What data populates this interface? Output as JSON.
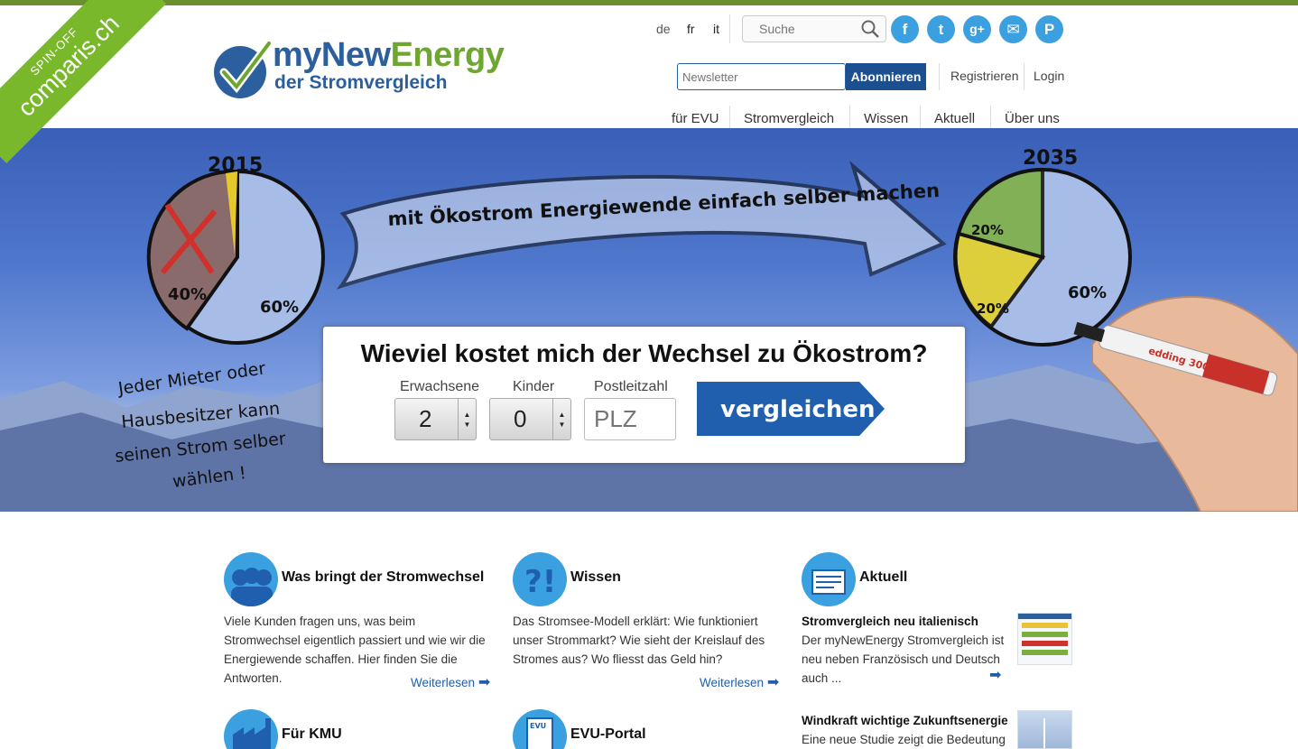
{
  "ribbon": {
    "small": "SPIN-OFF",
    "big": "comparis.ch"
  },
  "logo": {
    "brand_a": "myNew",
    "brand_b": "Energy",
    "subtitle": "der Stromvergleich"
  },
  "languages": [
    "de",
    "fr",
    "it"
  ],
  "search": {
    "placeholder": "Suche",
    "icon": "search-icon"
  },
  "social": [
    {
      "name": "facebook-icon",
      "glyph": "f"
    },
    {
      "name": "twitter-icon",
      "glyph": "t"
    },
    {
      "name": "googleplus-icon",
      "glyph": "g+"
    },
    {
      "name": "email-icon",
      "glyph": "✉"
    },
    {
      "name": "pinterest-icon",
      "glyph": "P"
    }
  ],
  "newsletter": {
    "placeholder": "Newsletter",
    "button": "Abonnieren"
  },
  "account": {
    "register": "Registrieren",
    "login": "Login"
  },
  "nav": [
    "für EVU",
    "Stromvergleich",
    "Wissen",
    "Aktuell",
    "Über uns"
  ],
  "hero": {
    "year_left": "2015",
    "year_right": "2035",
    "arrow_text": "mit Ökostrom Energiewende einfach selber machen",
    "pie_left": {
      "nuclear": "40%",
      "hydro": "60%"
    },
    "pie_right": {
      "wind": "20%",
      "solar": "20%",
      "hydro": "60%"
    },
    "handwriting": [
      "Jeder Mieter oder",
      "Hausbesitzer kann",
      "seinen Strom selber",
      "wählen !"
    ],
    "marker_label": "edding 3000"
  },
  "calculator": {
    "title": "Wieviel kostet mich der Wechsel zu Ökostrom?",
    "adults_label": "Erwachsene",
    "adults_value": "2",
    "children_label": "Kinder",
    "children_value": "0",
    "zip_label": "Postleitzahl",
    "zip_placeholder": "PLZ",
    "compare_button": "vergleichen"
  },
  "columns": [
    {
      "title": "Was bringt der Stromwechsel",
      "text": "Viele Kunden fragen uns, was beim Stromwechsel eigentlich passiert und wie wir die Energiewende schaffen. Hier finden Sie die Antworten.",
      "more": "Weiterlesen"
    },
    {
      "title": "Wissen",
      "text": "Das Stromsee-Modell erklärt: Wie funktioniert unser Strommarkt? Wie sieht der Kreislauf des Stromes aus? Wo fliesst das Geld hin?",
      "more": "Weiterlesen"
    },
    {
      "title": "Aktuell",
      "news": [
        {
          "title": "Stromvergleich neu italienisch",
          "text": "Der myNewEnergy Stromvergleich ist neu neben Französisch und Deutsch auch ..."
        },
        {
          "title": "Windkraft wichtige Zukunftsenergie",
          "text": "Eine neue Studie zeigt die Bedeutung"
        }
      ]
    }
  ],
  "lower_columns": [
    {
      "title": "Für KMU"
    },
    {
      "title": "EVU-Portal",
      "icon_label": "EVU"
    }
  ],
  "colors": {
    "brand_blue": "#2c5f9e",
    "brand_green": "#6ea72f",
    "accent_blue": "#3aa0e0",
    "button_blue": "#1c4f8f",
    "ribbon_green": "#78b82a"
  }
}
